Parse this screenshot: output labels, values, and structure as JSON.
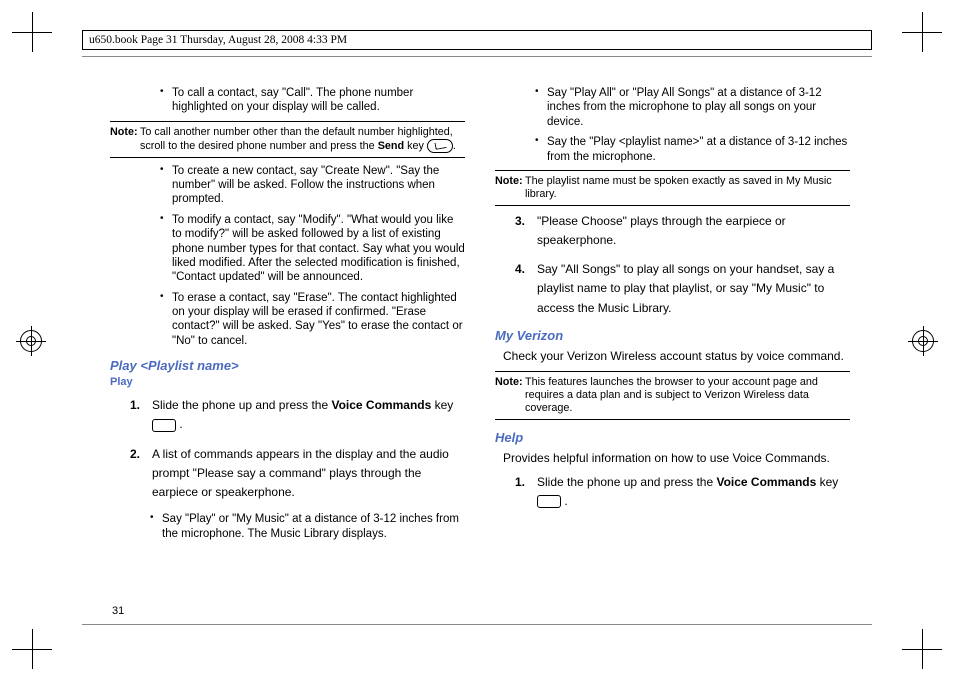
{
  "header": {
    "text": "u650.book  Page 31  Thursday, August 28, 2008  4:33 PM"
  },
  "pageNumber": "31",
  "left": {
    "b1": "To call a contact, say \"Call\". The phone number highlighted on your display will be called.",
    "note1_label": "Note:",
    "note1_before": "To call another number other than the default number highlighted, scroll to the desired phone number and press the ",
    "note1_sendWord": "Send",
    "note1_after": " key ",
    "b2": "To create a new contact, say \"Create New\". \"Say the number\" will be asked. Follow the instructions when prompted.",
    "b3": "To modify a contact, say \"Modify\". \"What would you like to modify?\" will be asked followed by a list of existing phone number types for that contact. Say what you would liked modified. After the selected modification is finished, \"Contact updated\" will be announced.",
    "b4": "To erase a contact, say \"Erase\". The contact highlighted on your display will be erased if confirmed. \"Erase contact?\" will be asked. Say \"Yes\" to erase the contact or \"No\" to cancel.",
    "h_play": "Play <Playlist name>",
    "h_sub": "Play",
    "s1_before": "Slide the phone up and press the ",
    "s1_bold": "Voice Commands",
    "s1_after": " key ",
    "s2": "A list of commands appears in the display and the audio prompt \"Please say a command\" plays through the earpiece or speakerphone.",
    "sb1": "Say \"Play\" or \"My Music\" at a distance of 3-12 inches from the microphone. The Music Library displays."
  },
  "right": {
    "sb2": "Say \"Play All\" or \"Play All Songs\" at a distance of 3-12 inches from the microphone to play all songs on your device.",
    "sb3": "Say the \"Play <playlist name>\" at a distance of 3-12 inches from the microphone.",
    "note2_label": "Note:",
    "note2_body": "The playlist name must be spoken exactly as saved in My Music library.",
    "s3": "\"Please Choose\" plays through the earpiece or speakerphone.",
    "s4": "Say \"All Songs\" to play all songs on your handset, say a playlist name to play that playlist, or say \"My Music\" to access the Music Library.",
    "h_myv": "My Verizon",
    "p_myv": "Check your Verizon Wireless account status by voice command.",
    "note3_label": "Note:",
    "note3_body": "This features launches the browser to your account page and requires a data plan and is subject to Verizon Wireless data coverage.",
    "h_help": "Help",
    "p_help": "Provides helpful information on how to use Voice Commands.",
    "s1h_before": "Slide the phone up and press the ",
    "s1h_bold": "Voice Commands",
    "s1h_after": " key "
  }
}
